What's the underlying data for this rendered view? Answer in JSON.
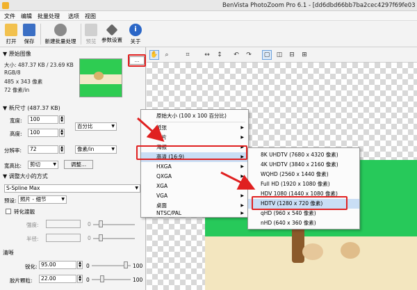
{
  "window": {
    "title": "BenVista PhotoZoom Pro 6.1 - [dd6dbd66bb7ba2cec4297f69fe03"
  },
  "menubar": {
    "items": [
      "文件",
      "编辑",
      "批量处理",
      "选项",
      "视图"
    ]
  },
  "toolbar": {
    "open": "打开",
    "save": "保存",
    "new_batch": "新建批量处理",
    "print": "预览",
    "params": "参数设置",
    "about": "关于"
  },
  "panel": {
    "original_header": "▼ 原始图像",
    "size": "大小: 487.37 KB / 23.69 KB",
    "mode": "RGB/8",
    "dims": "485 x 343 像素",
    "dpi": "72 像素/in",
    "new_size_header": "▼ 新尺寸 (487.37 KB)",
    "dd_button": "...",
    "width_label": "宽度:",
    "width_value": "100",
    "height_label": "高度:",
    "height_value": "100",
    "unit_percent": "百分比",
    "resolution_label": "分辨率:",
    "resolution_value": "72",
    "unit_ppi": "像素/in",
    "aspect_label": "宽高比:",
    "aspect_value": "剪切",
    "adjust_button": "调整...",
    "method_header": "▼ 调整大小的方式",
    "method_value": "S-Spline Max",
    "preset_label": "预设:",
    "preset_value": "照片 - 细节",
    "soften_label": "转化渡靓",
    "strength_label": "强度:",
    "strength_num": "0",
    "radius_label": "半径:",
    "radius_num": "0",
    "sharpen_header": "清晰",
    "sharpen_label": "锐化:",
    "sharpen_value": "95.00",
    "sharpen_min": "0",
    "sharpen_max": "100",
    "film_label": "胶片颗粒:",
    "film_value": "22.00",
    "film_min": "0",
    "film_max": "100"
  },
  "context_menu": {
    "items": [
      "原始大小 (100 x 100 百分比)",
      "纸张",
      "照片",
      "海报",
      "高清 (16:9)",
      "HXGA",
      "QXGA",
      "XGA",
      "VGA",
      "桌面",
      "NTSC/PAL"
    ]
  },
  "hd_submenu": {
    "items": [
      "8K UHDTV (7680 x 4320 像素)",
      "4K UHDTV (3840 x 2160 像素)",
      "WQHD (2560 x 1440 像素)",
      "Full HD (1920 x 1080 像素)",
      "HDV 1080 (1440 x 1080 像素)",
      "HDTV (1280 x 720 像素)",
      "qHD (960 x 540 像素)",
      "nHD (640 x 360 像素)"
    ]
  },
  "colors": {
    "highlight": "#c9def5",
    "annotation": "#e02020",
    "preview_green": "#27c95a"
  }
}
